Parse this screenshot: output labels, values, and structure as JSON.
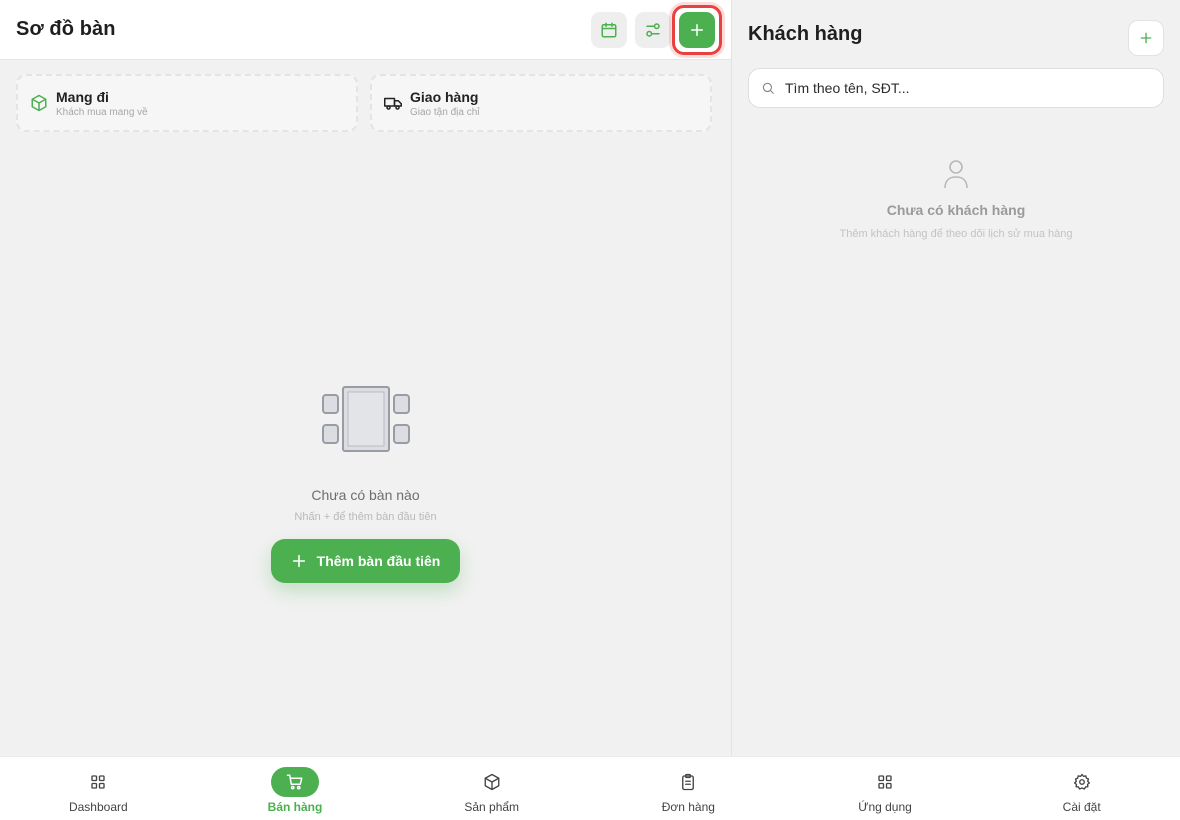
{
  "colors": {
    "accent": "#4caf50",
    "highlight": "#e8413f",
    "background": "#f1f1f1",
    "surface": "#ffffff"
  },
  "header": {
    "title": "Sơ đồ bàn",
    "actions": [
      {
        "name": "calendar-icon"
      },
      {
        "name": "sliders-icon"
      },
      {
        "name": "plus-icon"
      }
    ]
  },
  "order_types": [
    {
      "title": "Mang đi",
      "subtitle": "Khách mua mang về",
      "icon": "package-icon"
    },
    {
      "title": "Giao hàng",
      "subtitle": "Giao tận địa chỉ",
      "icon": "truck-icon"
    }
  ],
  "tables_empty": {
    "title": "Chưa có bàn nào",
    "subtitle": "Nhấn + để thêm bàn đầu tiên",
    "cta_label": "Thêm bàn đầu tiên"
  },
  "customers": {
    "title": "Khách hàng",
    "search_placeholder": "Tìm theo tên, SĐT...",
    "empty_title": "Chưa có khách hàng",
    "empty_subtitle": "Thêm khách hàng để theo dõi lịch sử mua hàng"
  },
  "bottom_nav": {
    "items": [
      {
        "label": "Dashboard",
        "icon": "grid-icon",
        "active": false
      },
      {
        "label": "Bán hàng",
        "icon": "cart-icon",
        "active": true
      },
      {
        "label": "Sản phẩm",
        "icon": "box-icon",
        "active": false
      },
      {
        "label": "Đơn hàng",
        "icon": "clipboard-icon",
        "active": false
      },
      {
        "label": "Ứng dụng",
        "icon": "apps-icon",
        "active": false
      },
      {
        "label": "Cài đặt",
        "icon": "gear-icon",
        "active": false
      }
    ]
  }
}
